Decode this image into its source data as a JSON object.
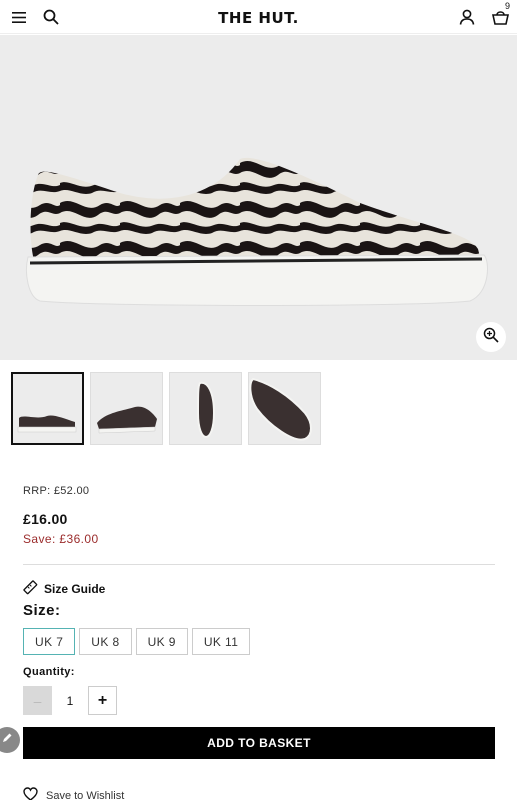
{
  "header": {
    "logo": "THE HUT.",
    "basket_count": "9",
    "icons": [
      "menu-icon",
      "search-icon",
      "account-icon",
      "basket-icon"
    ]
  },
  "gallery": {
    "zoom_icon": "zoom-in-icon",
    "thumbnails": [
      "side view",
      "angle view",
      "front view",
      "top view"
    ]
  },
  "pricing": {
    "rrp": "RRP: £52.00",
    "price": "£16.00",
    "save": "Save: £36.00",
    "save_color": "#9b2c2c"
  },
  "size": {
    "guide_label": "Size Guide",
    "label": "Size:",
    "options": [
      "UK 7",
      "UK 8",
      "UK 9",
      "UK 11"
    ],
    "selected": "UK 7",
    "selected_color": "#55b3b3"
  },
  "quantity": {
    "label": "Quantity:",
    "value": "1",
    "minus": "–",
    "plus": "+"
  },
  "actions": {
    "add_to_basket": "ADD TO BASKET",
    "wishlist": "Save to Wishlist"
  }
}
